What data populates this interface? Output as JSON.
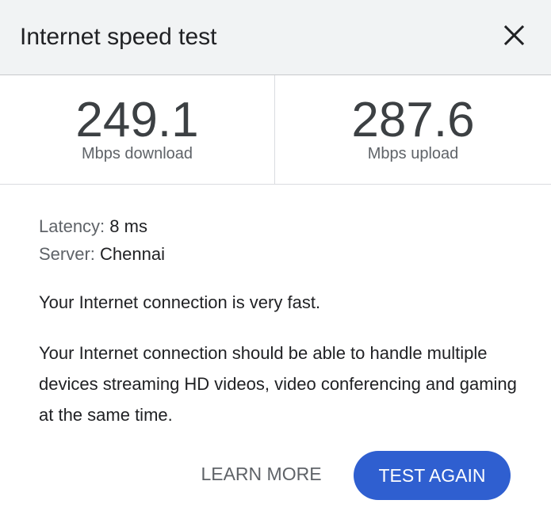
{
  "header": {
    "title": "Internet speed test",
    "close_icon": "close-icon"
  },
  "stats": {
    "download": {
      "value": "249.1",
      "unit": "Mbps download"
    },
    "upload": {
      "value": "287.6",
      "unit": "Mbps upload"
    }
  },
  "details": {
    "latency": {
      "label": "Latency:",
      "value": "8 ms"
    },
    "server": {
      "label": "Server:",
      "value": "Chennai"
    }
  },
  "summary": "Your Internet connection is very fast.",
  "description": "Your Internet connection should be able to handle multiple devices streaming HD videos, video conferencing and gaming at the same time.",
  "actions": {
    "learn_more": "LEARN MORE",
    "test_again": "TEST AGAIN"
  },
  "colors": {
    "header_bg": "#f1f3f4",
    "primary_button": "#2f5fd0",
    "text_primary": "#202124",
    "text_secondary": "#5f6368"
  }
}
